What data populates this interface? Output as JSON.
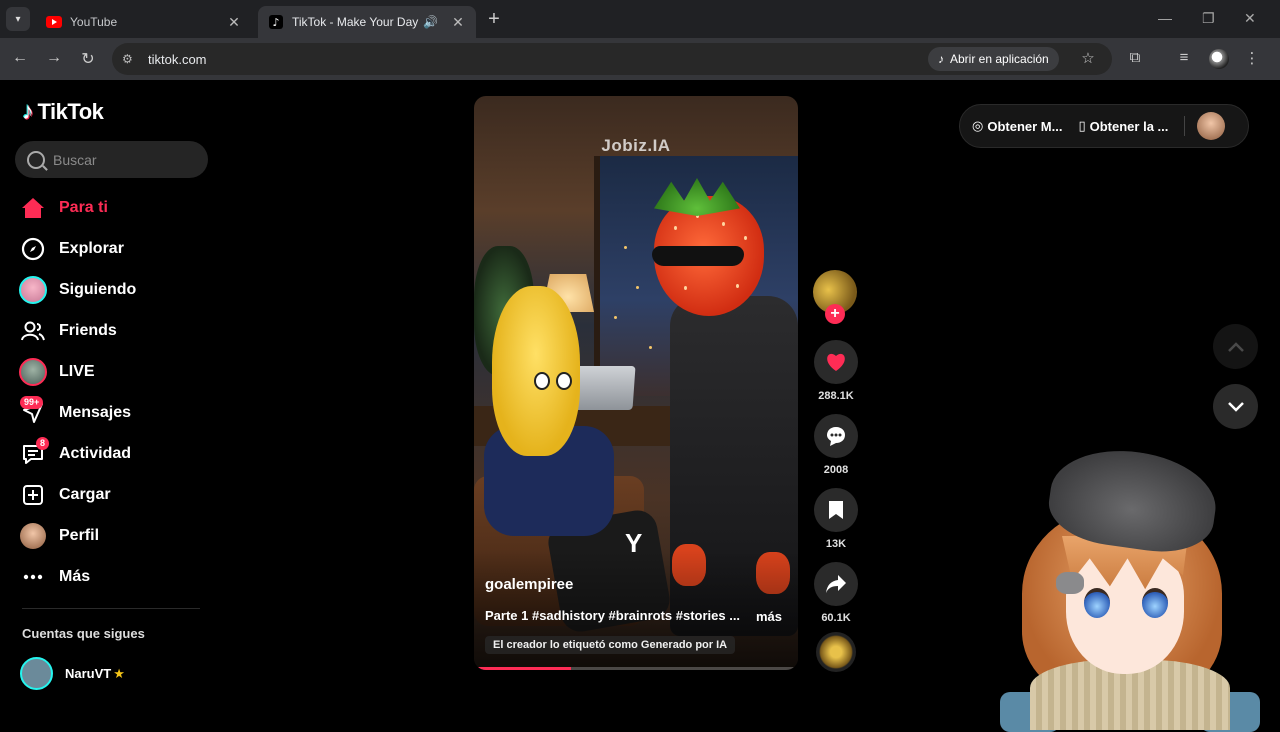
{
  "browser": {
    "tabs": [
      {
        "title": "YouTube",
        "active": false
      },
      {
        "title": "TikTok - Make Your Day",
        "active": true
      }
    ],
    "url": "tiktok.com",
    "open_app_label": "Abrir en aplicación"
  },
  "sidebar": {
    "logo_text": "TikTok",
    "search_placeholder": "Buscar",
    "items": [
      {
        "label": "Para ti",
        "icon": "home-icon",
        "active": true
      },
      {
        "label": "Explorar",
        "icon": "compass-icon"
      },
      {
        "label": "Siguiendo",
        "icon": "following-avatar"
      },
      {
        "label": "Friends",
        "icon": "friends-icon"
      },
      {
        "label": "LIVE",
        "icon": "live-avatar"
      },
      {
        "label": "Mensajes",
        "icon": "messages-icon",
        "badge": "99+"
      },
      {
        "label": "Actividad",
        "icon": "activity-icon",
        "badge": "8"
      },
      {
        "label": "Cargar",
        "icon": "upload-icon"
      },
      {
        "label": "Perfil",
        "icon": "profile-avatar"
      },
      {
        "label": "Más",
        "icon": "more-icon"
      }
    ],
    "following_title": "Cuentas que sigues",
    "following": [
      {
        "name": "NaruVT",
        "verified_icon": "star-icon"
      }
    ]
  },
  "video": {
    "watermark": "Jobiz.IA",
    "center_logo": "Y",
    "author": "goalempiree",
    "caption": "Parte 1 #sadhistory #brainrots #stories ...",
    "more_label": "más",
    "ai_label": "El creador lo etiquetó como Generado por IA",
    "progress": 0.3
  },
  "actions": {
    "likes": "288.1K",
    "comments": "2008",
    "saves": "13K",
    "shares": "60.1K"
  },
  "top_right": {
    "get_coins_label": "Obtener M...",
    "get_app_label": "Obtener la ..."
  },
  "colors": {
    "accent": "#fe2c55",
    "cyan": "#25f4ee",
    "background": "#000000"
  }
}
